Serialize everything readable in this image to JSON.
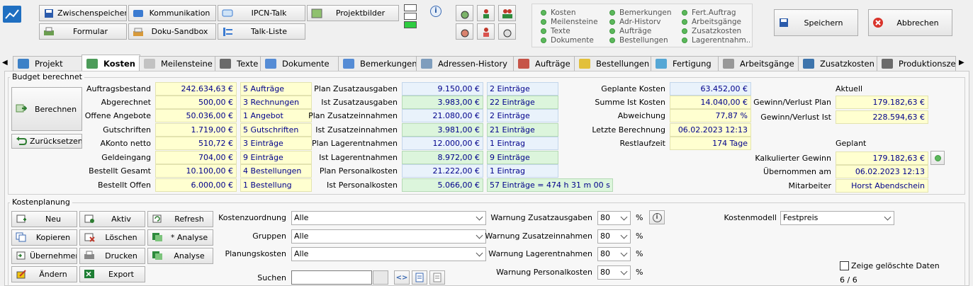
{
  "toolbar": {
    "zwischenspeichern": "Zwischenspeichern",
    "formular": "Formular",
    "kommunikation": "Kommunikation",
    "doku_sandbox": "Doku-Sandbox",
    "ipcn_talk": "IPCN-Talk",
    "talk_liste": "Talk-Liste",
    "projektbilder": "Projektbilder",
    "speichern": "Speichern",
    "abbrechen": "Abbrechen"
  },
  "legend": [
    "Kosten",
    "Meilensteine",
    "Texte",
    "Dokumente",
    "Bemerkungen",
    "Adr-Historv",
    "Aufträge",
    "Bestellungen",
    "Fert.Auftrag",
    "Arbeitsgänge",
    "Zusatzkosten",
    "Lagerentnahm..."
  ],
  "tabs": [
    "Projekt",
    "Kosten",
    "Meilensteine",
    "Texte",
    "Dokumente",
    "Bemerkungen",
    "Adressen-History",
    "Aufträge",
    "Bestellungen",
    "Fertigung",
    "Arbeitsgänge",
    "Zusatzkosten",
    "Produktionsze..."
  ],
  "budget": {
    "title": "Budget berechnet",
    "berechnen": "Berechnen",
    "zuruecksetzen": "Zurücksetzen",
    "col1": [
      {
        "label": "Auftragsbestand",
        "value": "242.634,63 €",
        "count": "5 Aufträge"
      },
      {
        "label": "Abgerechnet",
        "value": "500,00 €",
        "count": "3 Rechnungen"
      },
      {
        "label": "Offene Angebote",
        "value": "50.036,00 €",
        "count": "1 Angebot"
      },
      {
        "label": "Gutschriften",
        "value": "1.719,00 €",
        "count": "5 Gutschriften"
      },
      {
        "label": "AKonto netto",
        "value": "510,72 €",
        "count": "3 Einträge"
      },
      {
        "label": "Geldeingang",
        "value": "704,00 €",
        "count": "9 Einträge"
      },
      {
        "label": "Bestellt Gesamt",
        "value": "10.100,00 €",
        "count": "4 Bestellungen"
      },
      {
        "label": "Bestellt Offen",
        "value": "6.000,00 €",
        "count": "1 Bestellung"
      }
    ],
    "col2": [
      {
        "label": "Plan Zusatzausgaben",
        "value": "9.150,00 €",
        "count": "2 Einträge",
        "kind": "b"
      },
      {
        "label": "Ist Zusatzausgaben",
        "value": "3.983,00 €",
        "count": "22 Einträge",
        "kind": "g"
      },
      {
        "label": "Plan Zusatzeinnahmen",
        "value": "21.080,00 €",
        "count": "2 Einträge",
        "kind": "b"
      },
      {
        "label": "Ist Zusatzeinnahmen",
        "value": "3.981,00 €",
        "count": "21 Einträge",
        "kind": "g"
      },
      {
        "label": "Plan Lagerentnahmen",
        "value": "12.000,00 €",
        "count": "1 Eintrag",
        "kind": "b"
      },
      {
        "label": "Ist Lagerentnahmen",
        "value": "8.972,00 €",
        "count": "9 Einträge",
        "kind": "g"
      },
      {
        "label": "Plan Personalkosten",
        "value": "21.222,00 €",
        "count": "1 Eintrag",
        "kind": "b"
      },
      {
        "label": "Ist Personalkosten",
        "value": "5.066,00 €",
        "count": "57 Einträge = 474 h 31 m 00 s",
        "kind": "g"
      }
    ],
    "col3": [
      {
        "label": "Geplante Kosten",
        "value": "63.452,00 €",
        "kind": "b"
      },
      {
        "label": "Summe Ist Kosten",
        "value": "14.040,00 €",
        "kind": ""
      },
      {
        "label": "Abweichung",
        "value": "77,87 %",
        "kind": ""
      },
      {
        "label": "Letzte Berechnung",
        "value": "06.02.2023  12:13",
        "kind": ""
      },
      {
        "label": "Restlaufzeit",
        "value": "174 Tage",
        "kind": ""
      }
    ],
    "aktuell_title": "Aktuell",
    "gewinn_plan_label": "Gewinn/Verlust Plan",
    "gewinn_plan": "179.182,63 €",
    "gewinn_ist_label": "Gewinn/Verlust Ist",
    "gewinn_ist": "228.594,63 €",
    "geplant_title": "Geplant",
    "kalk_label": "Kalkulierter Gewinn",
    "kalk": "179.182,63 €",
    "uebernommen_label": "Übernommen am",
    "uebernommen": "06.02.2023 12:13",
    "mitarbeiter_label": "Mitarbeiter",
    "mitarbeiter": "Horst Abendschein"
  },
  "planung": {
    "title": "Kostenplanung",
    "buttons": {
      "neu": "Neu",
      "aktiv": "Aktiv",
      "refresh": "Refresh",
      "kopieren": "Kopieren",
      "loeschen": "Löschen",
      "analyse_star": "* Analyse",
      "uebernehmen": "Übernehmen",
      "drucken": "Drucken",
      "analyse": "Analyse",
      "aendern": "Ändern",
      "export": "Export"
    },
    "kostenzuordnung_label": "Kostenzuordnung",
    "kostenzuordnung": "Alle",
    "gruppen_label": "Gruppen",
    "gruppen": "Alle",
    "planungskosten_label": "Planungskosten",
    "planungskosten": "Alle",
    "suchen_label": "Suchen",
    "suchen_value": "",
    "warn_zusatzausgaben_label": "Warnung Zusatzausgaben",
    "warn_zusatzausgaben": "80",
    "warn_zusatzeinnahmen_label": "Warnung Zusatzeinnahmen",
    "warn_zusatzeinnahmen": "80",
    "warn_lager_label": "Warnung Lagerentnahmen",
    "warn_lager": "80",
    "warn_personal_label": "Warnung Personalkosten",
    "warn_personal": "80",
    "percent": "%",
    "kostenmodell_label": "Kostenmodell",
    "kostenmodell": "Festpreis",
    "zeige_geloeschte": "Zeige gelöschte Daten",
    "paging": "6 / 6"
  }
}
